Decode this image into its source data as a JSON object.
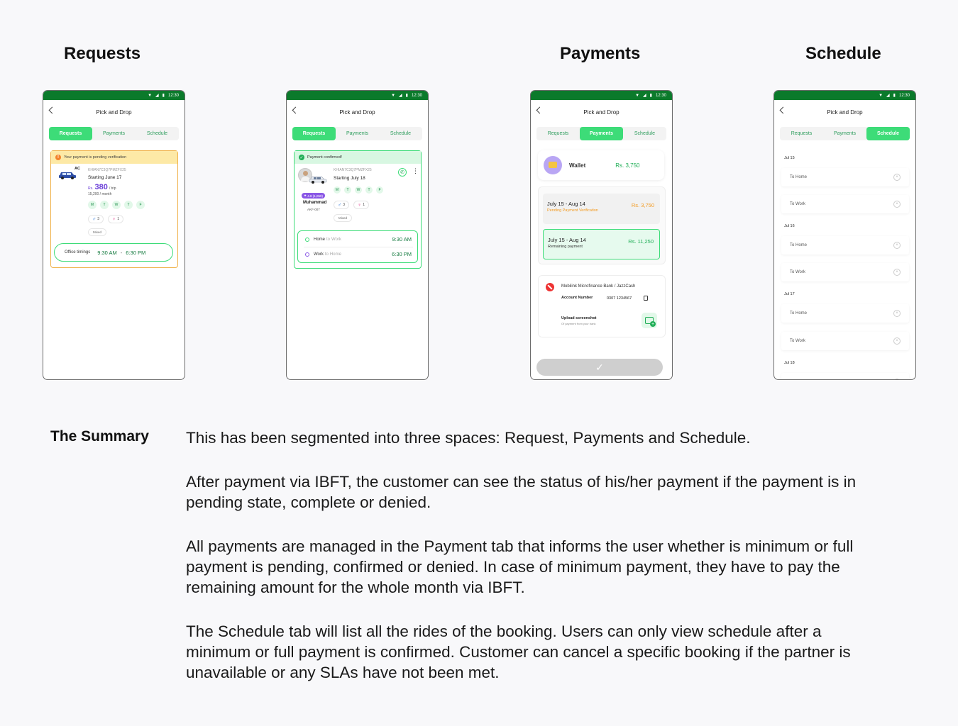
{
  "sections": {
    "requests": "Requests",
    "payments": "Payments",
    "schedule": "Schedule"
  },
  "phone": {
    "time": "12:30",
    "header_title": "Pick and Drop",
    "tabs": [
      "Requests",
      "Payments",
      "Schedule"
    ]
  },
  "request1": {
    "banner": "Your payment is pending verification",
    "ac_label": "AC",
    "plate": "KHIAN7C3Q7PMZFX25",
    "starting": "Starting June 17",
    "price_prefix": "Rs.",
    "price": "380",
    "price_suffix": "/ trip",
    "monthly": "15,200 / month",
    "days": [
      "M",
      "T",
      "W",
      "T",
      "F"
    ],
    "male_count": "3",
    "female_count": "1",
    "mixed": "Mixed",
    "office_label": "Office timings",
    "time_from": "9:30 AM",
    "time_dash": "-",
    "time_to": "6:30 PM"
  },
  "request2": {
    "banner": "Payment confirmed!",
    "plate": "KHIAN7C3Q7PMZFX25",
    "starting": "Starting July 18",
    "rating": "4.8 (1,050)",
    "driver_name": "Muhammad",
    "driver_car": "AKF-007",
    "days": [
      "M",
      "T",
      "W",
      "T",
      "F"
    ],
    "male_count": "3",
    "female_count": "1",
    "mixed": "Mixed",
    "routes": [
      {
        "from": "Home",
        "to_word": "to",
        "to": "Work",
        "time": "9:30 AM"
      },
      {
        "from": "Work",
        "to_word": "to",
        "to": "Home",
        "time": "6:30 PM"
      }
    ]
  },
  "payments": {
    "wallet_label": "Wallet",
    "wallet_amount": "Rs. 3,750",
    "items": [
      {
        "range": "July 15 - Aug 14",
        "status": "Pending Payment Verification",
        "amount": "Rs. 3,750"
      },
      {
        "range": "July 15 - Aug 14",
        "status": "Remaining payment",
        "amount": "Rs. 11,250"
      }
    ],
    "bank_name": "Mobilink Microfinance Bank / JazzCash",
    "account_label": "Account Number",
    "account_number": "0307 1234567",
    "upload_label": "Upload screenshot",
    "upload_sub": "Of payment from your bank",
    "submit_icon": "check-icon"
  },
  "schedule": {
    "days": [
      {
        "date": "Jul 15",
        "rides": [
          "To Home",
          "To Work"
        ]
      },
      {
        "date": "Jul 16",
        "rides": [
          "To Home",
          "To Work"
        ]
      },
      {
        "date": "Jul 17",
        "rides": [
          "To Home",
          "To Work"
        ]
      },
      {
        "date": "Jul 18",
        "rides": []
      }
    ]
  },
  "summary": {
    "heading": "The Summary",
    "paragraphs": [
      "This has been segmented into three spaces: Request, Payments and Schedule.",
      "After payment via IBFT, the customer can see the status of his/her payment if the payment is in pending state, complete or denied.",
      "All payments are managed in the Payment tab that informs the user whether is minimum or full payment is pending, confirmed or denied. In case of minimum payment, they have to pay the remaining amount for the whole month via IBFT.",
      "The Schedule tab will list all the rides of the booking. Users can only view schedule after a minimum or full payment is confirmed. Customer can cancel a specific booking if the partner is unavailable or any SLAs have not been met."
    ]
  },
  "colors": {
    "brand_green": "#3ddc78",
    "statusbar": "#0b7a2b",
    "pending": "#f39a1f",
    "purple": "#8a57e6"
  }
}
